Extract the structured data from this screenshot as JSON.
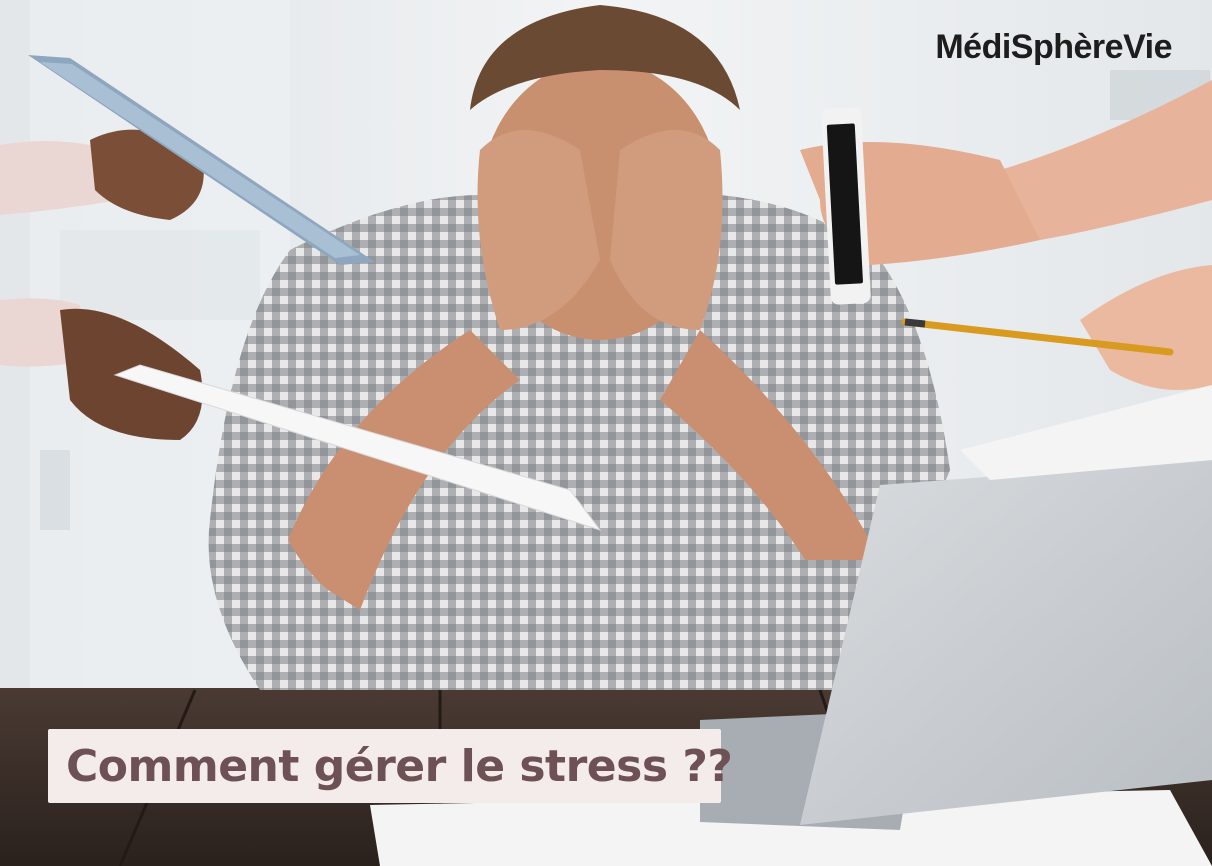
{
  "brand": {
    "name": "MédiSphèreVie"
  },
  "caption": {
    "text": "Comment gérer le stress ??"
  },
  "colors": {
    "caption_background": "#f3ecea",
    "caption_text": "#6e5155",
    "brand_text": "#1d1d1d"
  },
  "icons": [
    "tablet-icon",
    "smartphone-icon",
    "pencil-icon",
    "document-icon",
    "laptop-icon"
  ]
}
